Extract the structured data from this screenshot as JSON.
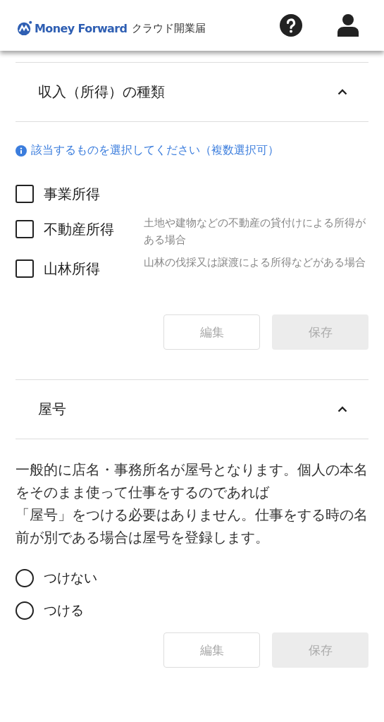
{
  "header": {
    "brand": "Money Forward",
    "product": "クラウド開業届"
  },
  "sections": [
    {
      "title": "収入（所得）の種類",
      "expanded": true,
      "kind": "checkboxes",
      "hint": "該当するものを選択してください（複数選択可）",
      "options": [
        {
          "label": "事業所得",
          "checked": false
        },
        {
          "label": "不動産所得",
          "checked": false,
          "description": "土地や建物などの不動産の貸付けによる所得がある場合"
        },
        {
          "label": "山林所得",
          "checked": false,
          "description": "山林の伐採又は譲渡による所得などがある場合"
        }
      ],
      "buttons": [
        {
          "label": "編集",
          "kind": "outline",
          "disabled": true
        },
        {
          "label": "保存",
          "kind": "filled",
          "disabled": true
        }
      ]
    },
    {
      "title": "屋号",
      "expanded": true,
      "kind": "radios",
      "description": [
        "一般的に店名・事務所名が屋号となります。個人の本名をそのまま使って仕事をするのであれば",
        "「屋号」をつける必要はありません。仕事をする時の名前が別である場合は屋号を登録します。"
      ],
      "options": [
        {
          "label": "つけない",
          "selected": false
        },
        {
          "label": "つける",
          "selected": false
        }
      ],
      "buttons": [
        {
          "label": "編集",
          "kind": "outline",
          "disabled": true
        },
        {
          "label": "保存",
          "kind": "filled",
          "disabled": true
        }
      ]
    }
  ]
}
